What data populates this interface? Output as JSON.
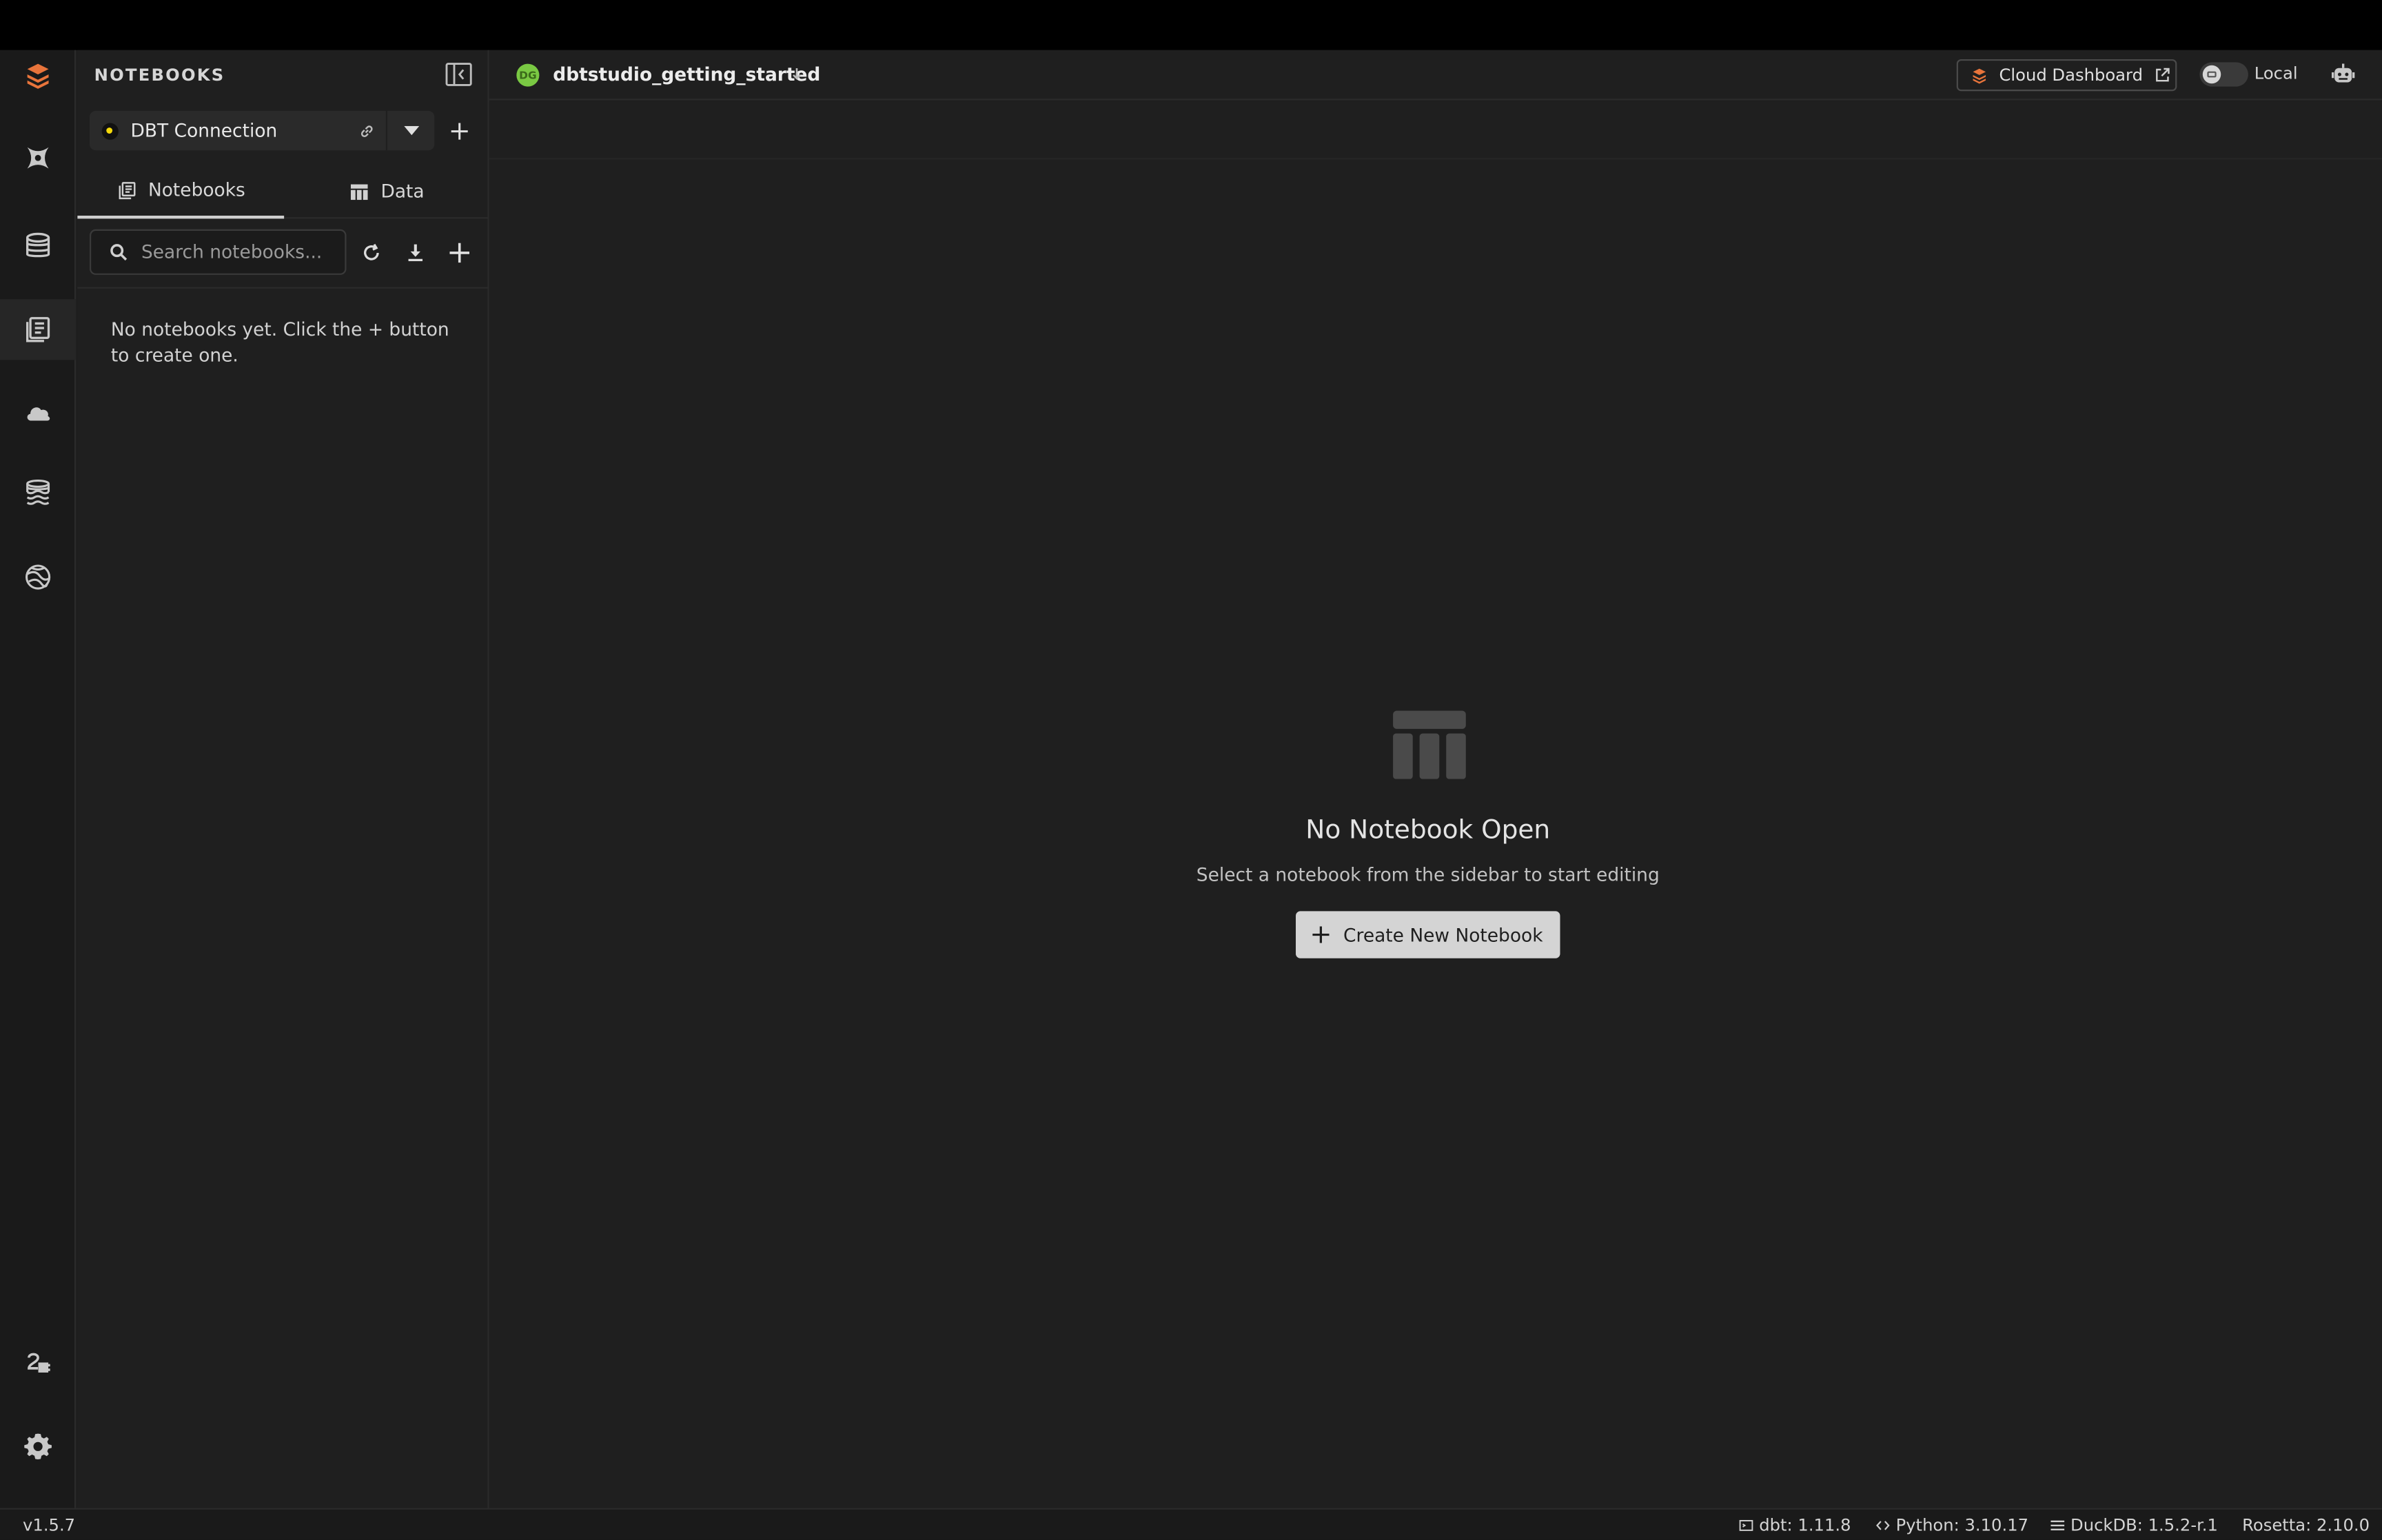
{
  "sidebar": {
    "header_title": "NOTEBOOKS",
    "connection_name": "DBT Connection",
    "tabs": [
      {
        "label": "Notebooks"
      },
      {
        "label": "Data"
      }
    ],
    "search_placeholder": "Search notebooks...",
    "empty_message": "No notebooks yet. Click the + button to create one."
  },
  "topbar": {
    "project_initials": "DG",
    "project_name": "dbtstudio_getting_started",
    "cloud_dashboard_label": "Cloud Dashboard",
    "mode_label": "Local"
  },
  "main": {
    "empty_title": "No Notebook Open",
    "empty_subtitle": "Select a notebook from the sidebar to start editing",
    "create_button_label": "Create New Notebook"
  },
  "statusbar": {
    "version": "v1.5.7",
    "dbt": "dbt: 1.11.8",
    "python": "Python: 3.10.17",
    "duckdb": "DuckDB: 1.5.2-r.1",
    "rosetta": "Rosetta: 2.10.0"
  },
  "colors": {
    "accent_orange": "#e8743b",
    "project_green": "#7ac943",
    "connection_yellow": "#f5d90a"
  }
}
